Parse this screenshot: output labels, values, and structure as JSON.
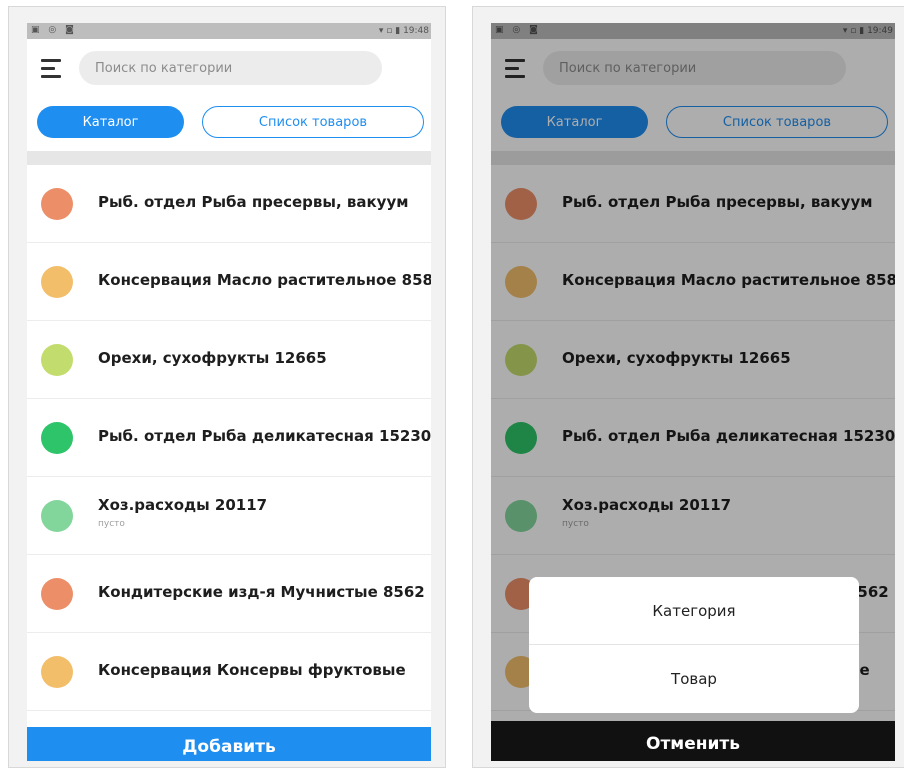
{
  "status_bar": {
    "icons_left": "▣ ◎ ◙",
    "icons_right": "▾ ▫ ▮",
    "time_left_screen": "19:48",
    "time_right_screen": "19:49"
  },
  "search": {
    "placeholder": "Поиск по категории",
    "value": ""
  },
  "tabs": {
    "catalog": "Каталог",
    "goods_list": "Список товаров"
  },
  "categories": [
    {
      "title": "Рыб. отдел Рыба пресервы, вакуум",
      "subtitle": "",
      "color": "#ec8f68"
    },
    {
      "title": "Консервация Масло растительное 858",
      "subtitle": "",
      "color": "#f2be6a"
    },
    {
      "title": "Орехи, сухофрукты 12665",
      "subtitle": "",
      "color": "#c3dc6e"
    },
    {
      "title": "Рыб. отдел Рыба деликатесная 15230",
      "subtitle": "",
      "color": "#2ec469"
    },
    {
      "title": "Хоз.расходы 20117",
      "subtitle": "пусто",
      "color": "#82d69c"
    },
    {
      "title": "Кондитерские изд-я Мучнистые 8562",
      "subtitle": "",
      "color": "#ec8f68"
    },
    {
      "title": "Консервация Консервы фруктовые",
      "subtitle": "",
      "color": "#f2be6a"
    }
  ],
  "add_button": "Добавить",
  "action_sheet": {
    "option_category": "Категория",
    "option_product": "Товар",
    "cancel": "Отменить"
  }
}
